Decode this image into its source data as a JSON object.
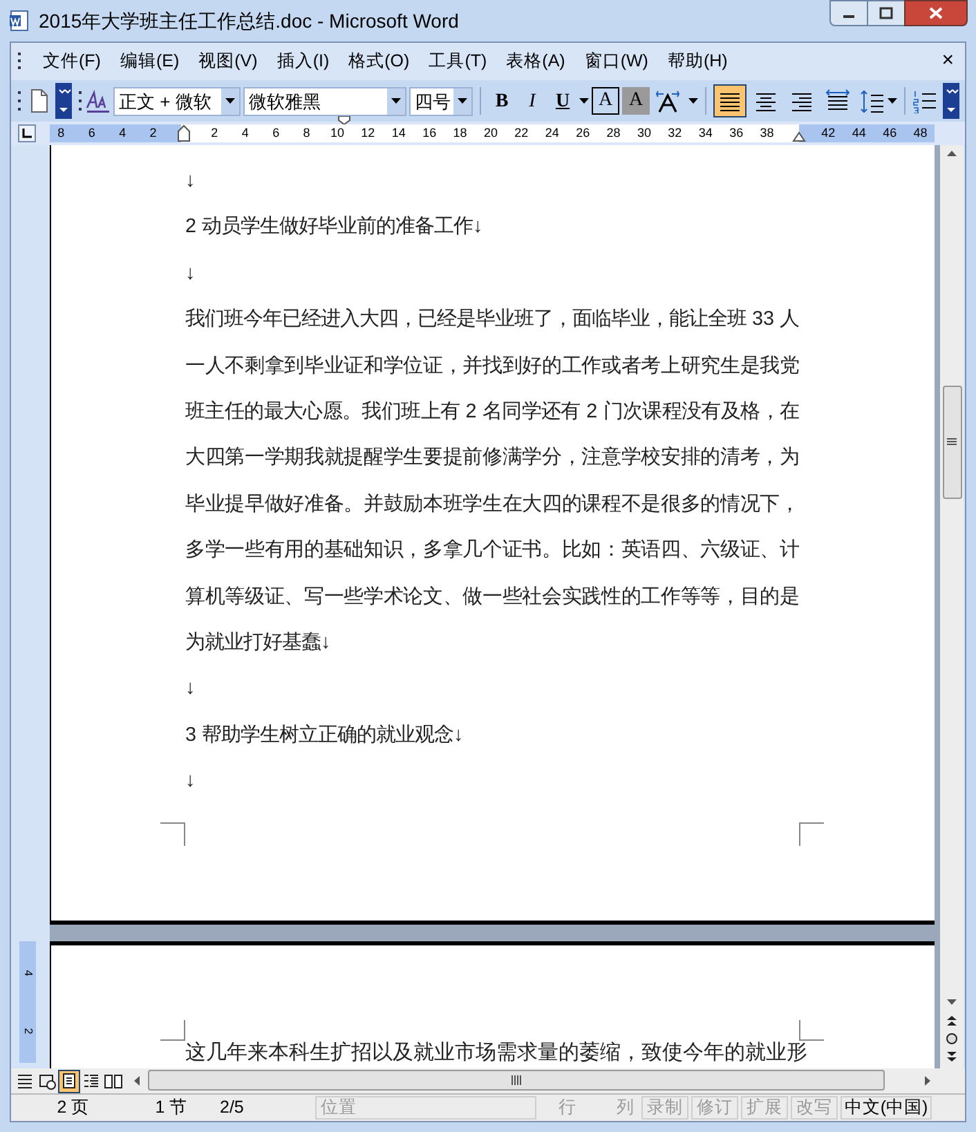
{
  "window": {
    "title": "2015年大学班主任工作总结.doc - Microsoft Word"
  },
  "menu": {
    "items": [
      "文件(F)",
      "编辑(E)",
      "视图(V)",
      "插入(I)",
      "格式(O)",
      "工具(T)",
      "表格(A)",
      "窗口(W)",
      "帮助(H)"
    ],
    "close": "×"
  },
  "toolbar": {
    "style": "正文 + 微软",
    "font": "微软雅黑",
    "size": "四号",
    "format_buttons": [
      {
        "kind": "bold",
        "label": "B"
      },
      {
        "kind": "italic",
        "label": "I"
      },
      {
        "kind": "underline",
        "label": "U"
      },
      {
        "kind": "border",
        "label": "A"
      },
      {
        "kind": "shading",
        "label": "A"
      }
    ],
    "align_buttons": [
      {
        "kind": "justify",
        "selected": true
      },
      {
        "kind": "center",
        "selected": false
      },
      {
        "kind": "right",
        "selected": false
      },
      {
        "kind": "distribute",
        "selected": false
      }
    ]
  },
  "ruler": {
    "left_labels": [
      "8",
      "6",
      "4",
      "2"
    ],
    "labels": [
      "2",
      "4",
      "6",
      "8",
      "10",
      "12",
      "14",
      "16",
      "18",
      "20",
      "22",
      "24",
      "26",
      "28",
      "30",
      "32",
      "34",
      "36",
      "38"
    ],
    "right_labels": [
      "42",
      "44",
      "46",
      "48"
    ]
  },
  "page_1": [
    {
      "kind": "empty",
      "text": "↓"
    },
    {
      "kind": "line",
      "text": "2 动员学生做好毕业前的准备工作↓"
    },
    {
      "kind": "empty",
      "text": "↓"
    },
    {
      "kind": "body",
      "text": "我们班今年已经进入大四，已经是毕业班了，面临毕业，能让全班 33 人一人不剩拿到毕业证和学位证，并找到好的工作或者考上研究生是我党班主任的最大心愿。我们班上有 2 名同学还有 2 门次课程没有及格，在大四第一学期我就提醒学生要提前修满学分，注意学校安排的清考，为毕业提早做好准备。并鼓励本班学生在大四的课程不是很多的情况下，多学一些有用的基础知识，多拿几个证书。比如：英语四、六级证、计算机等级证、写一些学术论文、做一些社会实践性的工作等等，目的是为就业打好基蠢↓"
    },
    {
      "kind": "empty",
      "text": "↓"
    },
    {
      "kind": "line",
      "text": "3 帮助学生树立正确的就业观念↓"
    },
    {
      "kind": "empty",
      "text": "↓"
    }
  ],
  "page_2": {
    "text": "这几年来本科生扩招以及就业市场需求量的萎缩，致使今年的就业形"
  },
  "vertical_ruler": [
    "4",
    "2"
  ],
  "view_buttons": [
    {
      "kind": "normal",
      "selected": false
    },
    {
      "kind": "web",
      "selected": false
    },
    {
      "kind": "print",
      "selected": true
    },
    {
      "kind": "outline",
      "selected": false
    },
    {
      "kind": "reading",
      "selected": false
    }
  ],
  "status_bar": [
    {
      "text": "2 页",
      "disabled": false
    },
    {
      "text": "1 节",
      "disabled": false
    },
    {
      "text": "2/5",
      "disabled": false
    },
    {
      "text": "位置",
      "disabled": true
    },
    {
      "text": "行",
      "disabled": true
    },
    {
      "text": "列",
      "disabled": true
    },
    {
      "text": "录制",
      "disabled": true
    },
    {
      "text": "修订",
      "disabled": true
    },
    {
      "text": "扩展",
      "disabled": true
    },
    {
      "text": "改写",
      "disabled": true
    },
    {
      "text": "中文(中国)",
      "disabled": false
    }
  ]
}
